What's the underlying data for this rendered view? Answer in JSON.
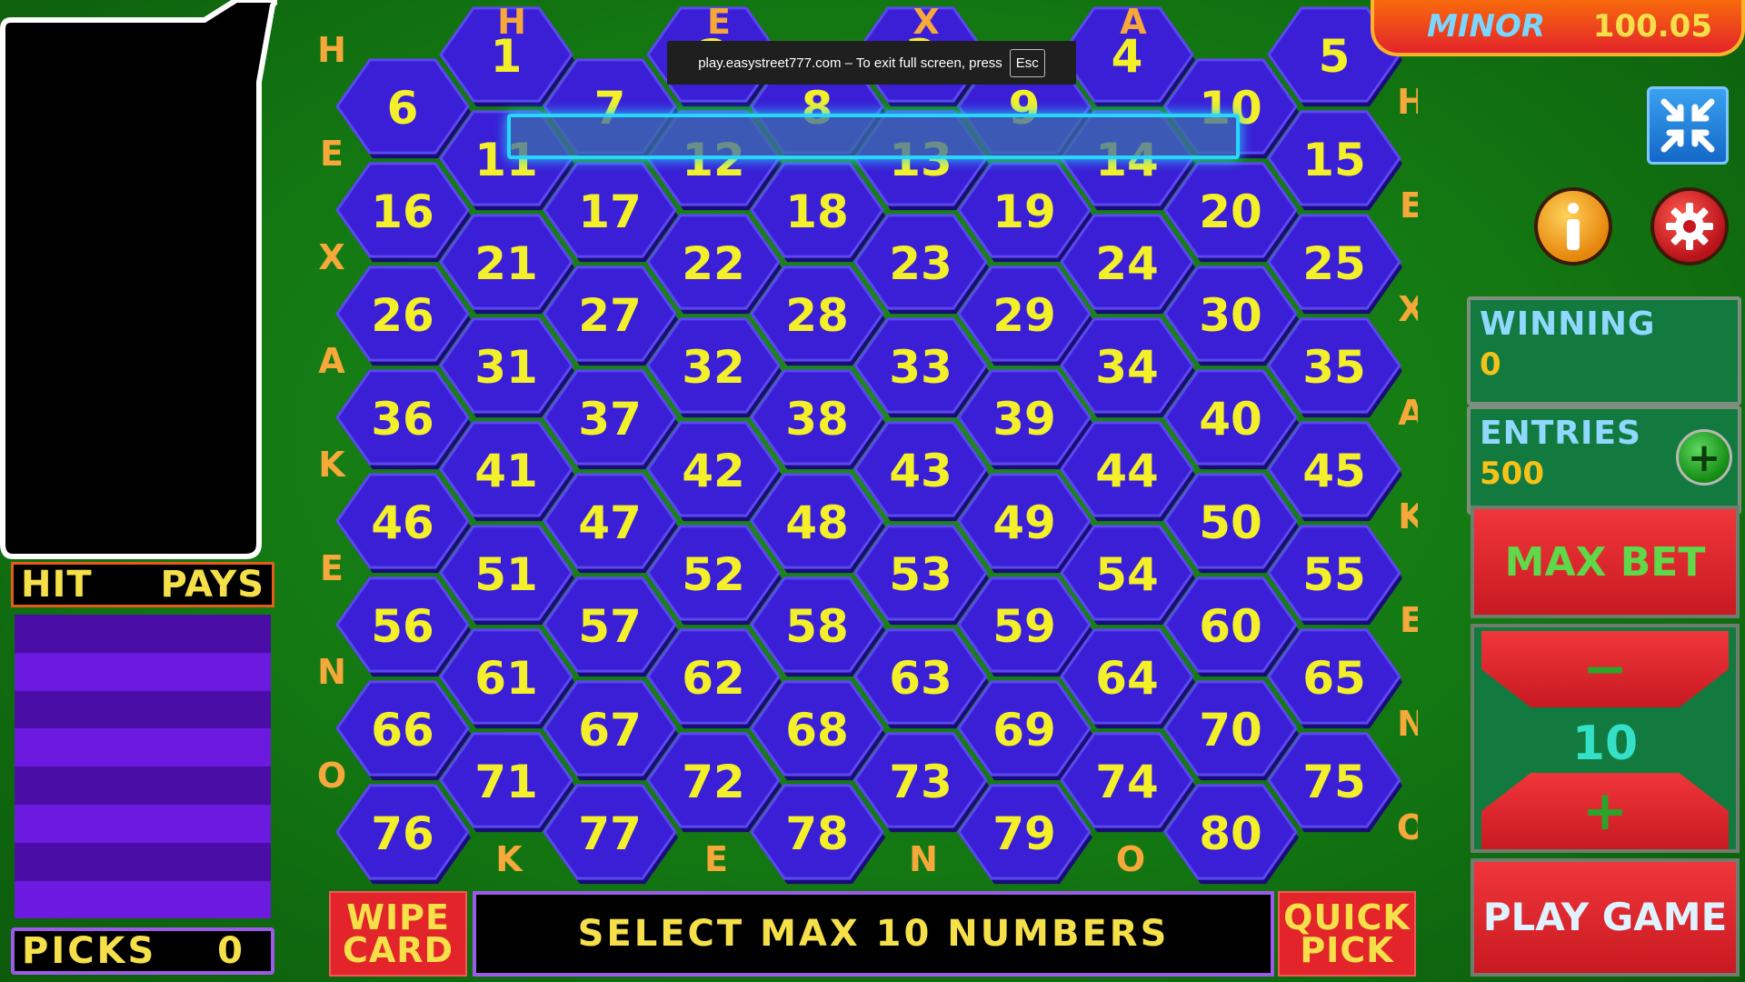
{
  "jackpot": {
    "label": "MINOR",
    "value": "100.05"
  },
  "fullscreen_notice": {
    "text": "play.easystreet777.com – To exit full screen, press",
    "key": "Esc"
  },
  "side_letters": {
    "left": [
      "H",
      "E",
      "X",
      "A",
      "K",
      "E",
      "N",
      "O"
    ],
    "right": [
      "H",
      "E",
      "X",
      "A",
      "K",
      "E",
      "N",
      "O"
    ],
    "top": [
      "H",
      "E",
      "X",
      "A"
    ],
    "bottom": [
      "K",
      "E",
      "N",
      "O"
    ]
  },
  "board": {
    "numbers": [
      1,
      2,
      3,
      4,
      5,
      6,
      7,
      8,
      9,
      10,
      11,
      12,
      13,
      14,
      15,
      16,
      17,
      18,
      19,
      20,
      21,
      22,
      23,
      24,
      25,
      26,
      27,
      28,
      29,
      30,
      31,
      32,
      33,
      34,
      35,
      36,
      37,
      38,
      39,
      40,
      41,
      42,
      43,
      44,
      45,
      46,
      47,
      48,
      49,
      50,
      51,
      52,
      53,
      54,
      55,
      56,
      57,
      58,
      59,
      60,
      61,
      62,
      63,
      64,
      65,
      66,
      67,
      68,
      69,
      70,
      71,
      72,
      73,
      74,
      75,
      76,
      77,
      78,
      79,
      80
    ]
  },
  "left_panel": {
    "hit_label": "HIT",
    "pays_label": "PAYS",
    "picks_label": "PICKS",
    "picks_value": "0"
  },
  "bottom_bar": {
    "wipe_label": "WIPE CARD",
    "message": "SELECT MAX 10 NUMBERS",
    "quick_label": "QUICK PICK"
  },
  "right_panel": {
    "winning_label": "WINNING",
    "winning_value": "0",
    "entries_label": "ENTRIES",
    "entries_value": "500",
    "max_bet_label": "MAX BET",
    "bet_value": "10",
    "play_label": "PLAY GAME"
  },
  "colors": {
    "background": "#137812",
    "hex_fill": "#3a1fd6",
    "number": "#f3f02a",
    "accent_red": "#e3242b",
    "accent_yellow": "#f6e04a"
  }
}
